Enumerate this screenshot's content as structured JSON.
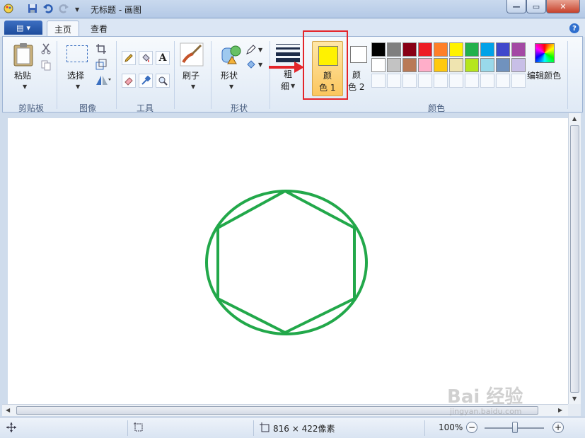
{
  "window": {
    "title": "无标题 - 画图",
    "buttons": {
      "minimize": "—",
      "maximize": "▭",
      "close": "✕"
    }
  },
  "quick_access": {
    "save_icon": "save-icon",
    "undo_icon": "undo-icon",
    "redo_icon": "redo-icon"
  },
  "tabs": {
    "home": "主页",
    "view": "查看"
  },
  "ribbon": {
    "clipboard": {
      "paste": "粘贴",
      "group": "剪贴板"
    },
    "image": {
      "select": "选择",
      "group": "图像"
    },
    "tools": {
      "group": "工具",
      "text_glyph": "A"
    },
    "brushes": {
      "label": "刷子"
    },
    "shapes": {
      "label": "形状",
      "group": "形状"
    },
    "size": {
      "label_top": "粗",
      "label_bottom": "细"
    },
    "color1": {
      "line1": "颜",
      "line2": "色 1",
      "color": "#fff200"
    },
    "color2": {
      "line1": "颜",
      "line2": "色 2",
      "color": "#ffffff"
    },
    "colors_group": "颜色",
    "edit_colors": "编辑颜色",
    "palette_row1": [
      "#000000",
      "#7f7f7f",
      "#880015",
      "#ed1c24",
      "#ff7f27",
      "#fff200",
      "#22b14c",
      "#00a2e8",
      "#3f48cc",
      "#a349a4"
    ],
    "palette_row2": [
      "#ffffff",
      "#c3c3c3",
      "#b97a57",
      "#ffaec9",
      "#ffc90e",
      "#efe4b0",
      "#b5e61d",
      "#99d9ea",
      "#7092be",
      "#c8bfe7"
    ]
  },
  "drawing": {
    "stroke_color": "#22a84a"
  },
  "statusbar": {
    "size": "816 × 422像素",
    "zoom": "100%",
    "zoom_out": "−",
    "zoom_in": "+"
  },
  "watermark": {
    "text": "Bai 经验",
    "sub": "jingyan.baidu.com"
  }
}
